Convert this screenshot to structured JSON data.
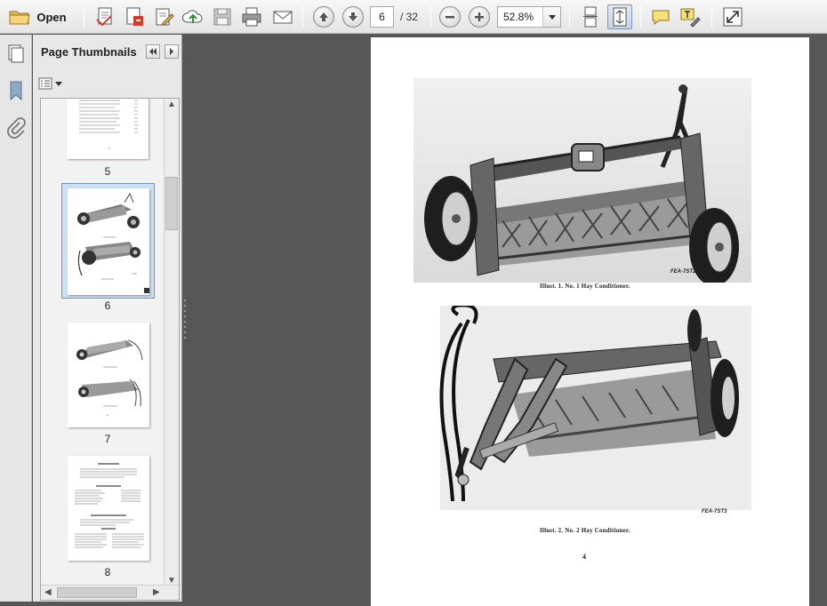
{
  "toolbar": {
    "open_label": "Open",
    "current_page": "6",
    "total_pages": "/ 32",
    "zoom": "52.8%"
  },
  "panel": {
    "title": "Page Thumbnails"
  },
  "thumbnails": [
    {
      "page": "5"
    },
    {
      "page": "6",
      "selected": true
    },
    {
      "page": "7"
    },
    {
      "page": "8"
    }
  ],
  "document": {
    "fig1_code": "FEA-7ST2",
    "fig1_caption": "Illust. 1.  No. 1 Hay Conditioner.",
    "fig2_code": "FEA-7ST3",
    "fig2_caption": "Illust. 2.  No. 2 Hay Conditioner.",
    "page_number": "4"
  },
  "colors": {
    "workspace": "#575757",
    "selection": "#cfe0f4",
    "selection_border": "#6f93c2",
    "folder": "#e8b84a"
  },
  "icons": [
    "folder-icon",
    "save-edit-icon",
    "pdf-create-icon",
    "edit-pdf-icon",
    "upload-icon",
    "save-icon",
    "print-icon",
    "email-icon",
    "previous-page-icon",
    "next-page-icon",
    "zoom-out-icon",
    "zoom-in-icon",
    "scroll-mode-icon",
    "fit-page-icon",
    "comment-icon",
    "highlight-icon",
    "full-screen-icon",
    "pages-icon",
    "bookmark-icon",
    "attachment-icon"
  ]
}
